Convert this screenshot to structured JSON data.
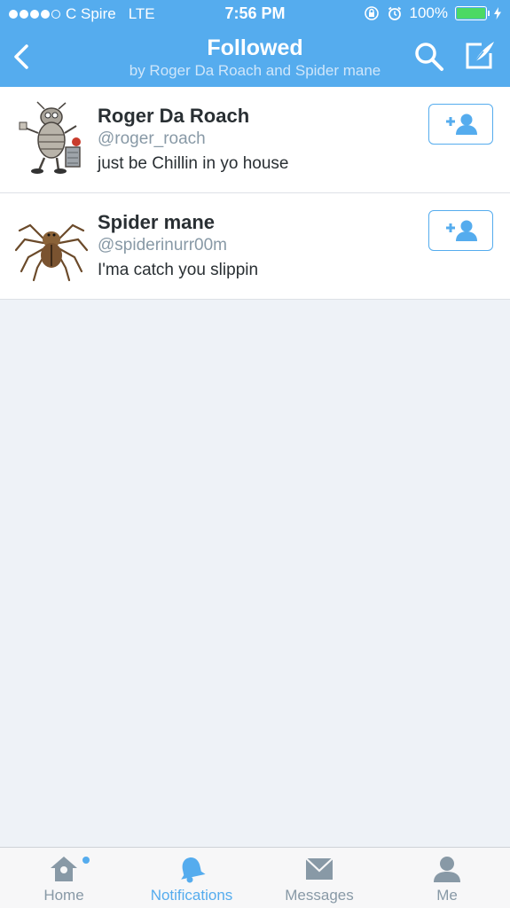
{
  "status_bar": {
    "carrier": "C Spire",
    "network": "LTE",
    "time": "7:56 PM",
    "battery": "100%",
    "signal_bars": 4
  },
  "nav": {
    "title": "Followed",
    "subtitle": "by Roger Da Roach and Spider mane"
  },
  "users": [
    {
      "name": "Roger Da Roach",
      "handle": "@roger_roach",
      "bio": "just be Chillin in yo house",
      "avatar": "cartoon-roach-avatar"
    },
    {
      "name": "Spider mane",
      "handle": "@spiderinurr00m",
      "bio": "I'ma catch you slippin",
      "avatar": "spider-avatar"
    }
  ],
  "tabs": [
    {
      "label": "Home",
      "icon": "home-icon",
      "active": false
    },
    {
      "label": "Notifications",
      "icon": "bell-icon",
      "active": true
    },
    {
      "label": "Messages",
      "icon": "envelope-icon",
      "active": false
    },
    {
      "label": "Me",
      "icon": "person-icon",
      "active": false
    }
  ],
  "colors": {
    "accent": "#55acee",
    "background": "#eef2f7",
    "battery": "#4cd964"
  }
}
